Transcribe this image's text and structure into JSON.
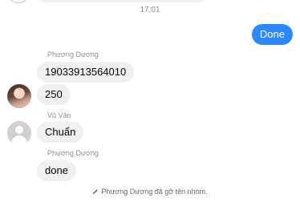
{
  "conversation": {
    "timestamp": "17:01",
    "outgoing": [
      {
        "text": "Done"
      }
    ],
    "groups": [
      {
        "sender": "Phương Dương",
        "messages": [
          "19033913564010",
          "250"
        ]
      },
      {
        "sender": "Vũ Vân",
        "messages": [
          "Chuẩn"
        ]
      },
      {
        "sender": "Phương Dương",
        "messages": [
          "done"
        ]
      }
    ],
    "system_notice": "Phương Dương đã gỡ tên nhóm."
  },
  "colors": {
    "outgoing_bubble": "#2d88ff",
    "incoming_bubble": "#f0f0f0",
    "meta_text": "#8a8d91"
  },
  "icons": {
    "system_notice": "pencil-icon",
    "default_avatar": "person-silhouette-icon"
  }
}
